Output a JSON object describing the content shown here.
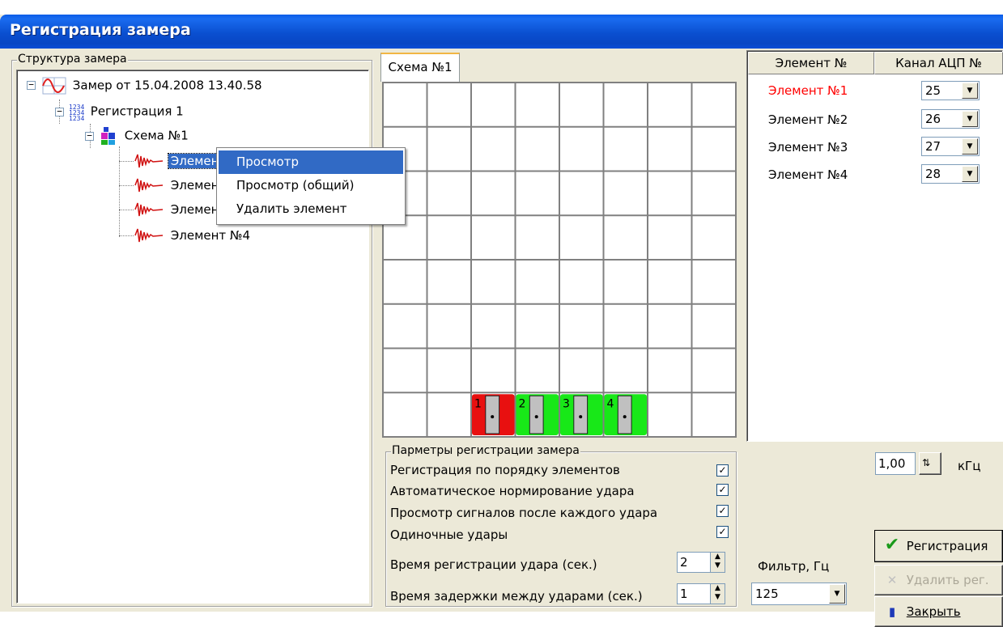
{
  "window": {
    "title": "Регистрация замера"
  },
  "structure": {
    "group_label": "Структура замера",
    "root": {
      "label": "Замер от 15.04.2008 13.40.58",
      "icon": "sine-wave-icon"
    },
    "registration": {
      "label": "Регистрация 1",
      "icon": "numbers-icon"
    },
    "scheme": {
      "label": "Схема №1",
      "icon": "scheme-icon"
    },
    "elements": [
      {
        "label": "Элемент №1",
        "icon": "signal-icon"
      },
      {
        "label": "Элемент №2",
        "icon": "signal-icon"
      },
      {
        "label": "Элемент №3",
        "icon": "signal-icon"
      },
      {
        "label": "Элемент №4",
        "icon": "signal-icon"
      }
    ]
  },
  "context_menu": {
    "items": [
      {
        "label": "Просмотр",
        "selected": true
      },
      {
        "label": "Просмотр (общий)",
        "selected": false
      },
      {
        "label": "Удалить элемент",
        "selected": false
      }
    ]
  },
  "scheme_tab": {
    "label": "Схема №1"
  },
  "grid": {
    "cols": 8,
    "rows": 8,
    "blocks": [
      {
        "number": "1",
        "color": "#e81010"
      },
      {
        "number": "2",
        "color": "#18e818"
      },
      {
        "number": "3",
        "color": "#18e818"
      },
      {
        "number": "4",
        "color": "#18e818"
      }
    ]
  },
  "channels": {
    "header_element": "Элемент №",
    "header_channel": "Канал АЦП №",
    "rows": [
      {
        "element": "Элемент №1",
        "channel": "25",
        "color": "#ff0000"
      },
      {
        "element": "Элемент №2",
        "channel": "26",
        "color": "#000000"
      },
      {
        "element": "Элемент №3",
        "channel": "27",
        "color": "#000000"
      },
      {
        "element": "Элемент №4",
        "channel": "28",
        "color": "#000000"
      }
    ]
  },
  "params": {
    "group_label": "Парметры регистрации замера",
    "checks": [
      {
        "label": "Регистрация по порядку элементов",
        "checked": true
      },
      {
        "label": "Автоматическое нормирование удара",
        "checked": true
      },
      {
        "label": "Просмотр сигналов после каждого удара",
        "checked": true
      },
      {
        "label": "Одиночные удары",
        "checked": true
      }
    ],
    "impact_time": {
      "label": "Время регистрации удара (сек.)",
      "value": "2"
    },
    "delay_time": {
      "label": "Время задержки между ударами (сек.)",
      "value": "1"
    }
  },
  "frequency": {
    "value": "1,00",
    "unit": "кГц"
  },
  "filter": {
    "label": "Фильтр, Гц",
    "value": "125"
  },
  "buttons": {
    "register": "Регистрация",
    "delete_reg": "Удалить рег.",
    "close": "Закрыть"
  }
}
